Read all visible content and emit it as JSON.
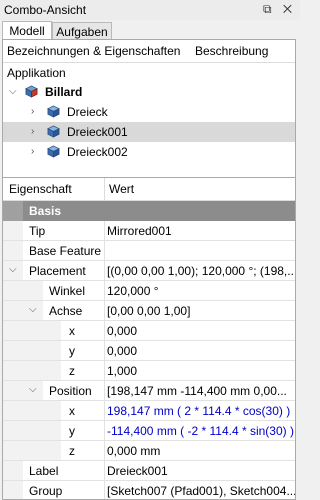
{
  "window": {
    "title": "Combo-Ansicht",
    "icons": "⧉ ✕"
  },
  "tabs": [
    {
      "label": "Modell"
    },
    {
      "label": "Aufgaben"
    }
  ],
  "tree": {
    "headers": {
      "col1": "Bezeichnungen & Eigenschaften",
      "col2": "Beschreibung"
    },
    "section": "Applikation",
    "root": {
      "label": "Billard"
    },
    "items": [
      {
        "label": "Dreieck"
      },
      {
        "label": "Dreieck001"
      },
      {
        "label": "Dreieck002"
      }
    ]
  },
  "props": {
    "headers": {
      "name": "Eigenschaft",
      "value": "Wert"
    },
    "group": "Basis",
    "rows": [
      {
        "name": "Tip",
        "value": "Mirrored001"
      },
      {
        "name": "Base Feature",
        "value": ""
      },
      {
        "name": "Placement",
        "value": "[(0,00 0,00 1,00); 120,000 °; (198,..."
      },
      {
        "name": "Winkel",
        "value": "120,000 °"
      },
      {
        "name": "Achse",
        "value": "[0,00 0,00 1,00]"
      },
      {
        "name": "x",
        "value": "0,000"
      },
      {
        "name": "y",
        "value": "0,000"
      },
      {
        "name": "z",
        "value": "1,000"
      },
      {
        "name": "Position",
        "value": "[198,147 mm  -114,400 mm  0,00..."
      },
      {
        "name": "x",
        "value": "198,147 mm  ( 2 * 114.4 * cos(30) )"
      },
      {
        "name": "y",
        "value": "-114,400 mm  ( -2 * 114.4 * sin(30) )"
      },
      {
        "name": "z",
        "value": "0,000 mm"
      },
      {
        "name": "Label",
        "value": "Dreieck001"
      },
      {
        "name": "Group",
        "value": "[Sketch007 (Pfad001), Sketch004..."
      }
    ]
  },
  "colors": {
    "selection": "#d9d9d9",
    "group_header": "#8c8c8c",
    "expression_text": "#0000c8"
  }
}
